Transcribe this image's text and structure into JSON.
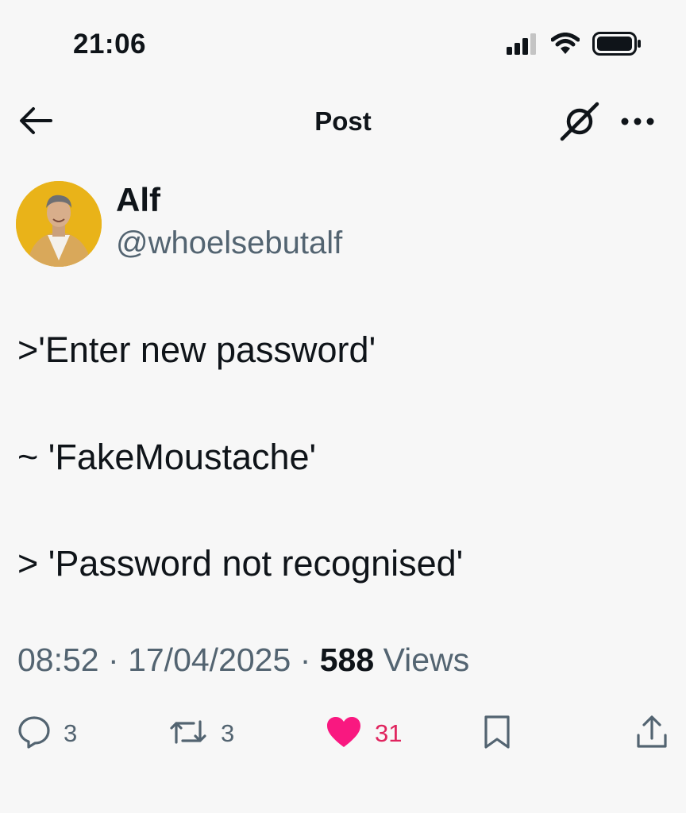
{
  "status_bar": {
    "time": "21:06",
    "icons": [
      "cellular-signal-icon",
      "wifi-icon",
      "battery-icon"
    ]
  },
  "nav": {
    "title": "Post",
    "icons": [
      "back-arrow-icon",
      "grok-icon",
      "more-icon"
    ]
  },
  "author": {
    "name": "Alf",
    "handle": "@whoelsebutalf"
  },
  "post": {
    "lines": [
      ">'Enter new password'",
      "~ 'FakeMoustache'",
      "> 'Password not recognised'"
    ],
    "time": "08:52",
    "separator": "·",
    "date": "17/04/2025",
    "views_count": "588",
    "views_label": "Views"
  },
  "actions": {
    "replies": "3",
    "reposts": "3",
    "likes": "31",
    "liked": true,
    "icons": [
      "reply-icon",
      "repost-icon",
      "heart-icon",
      "bookmark-icon",
      "share-icon"
    ]
  },
  "colors": {
    "background": "#f7f7f7",
    "text": "#0f1419",
    "secondary": "#536471",
    "like": "#f91880",
    "avatar_bg": "#e9b319"
  }
}
